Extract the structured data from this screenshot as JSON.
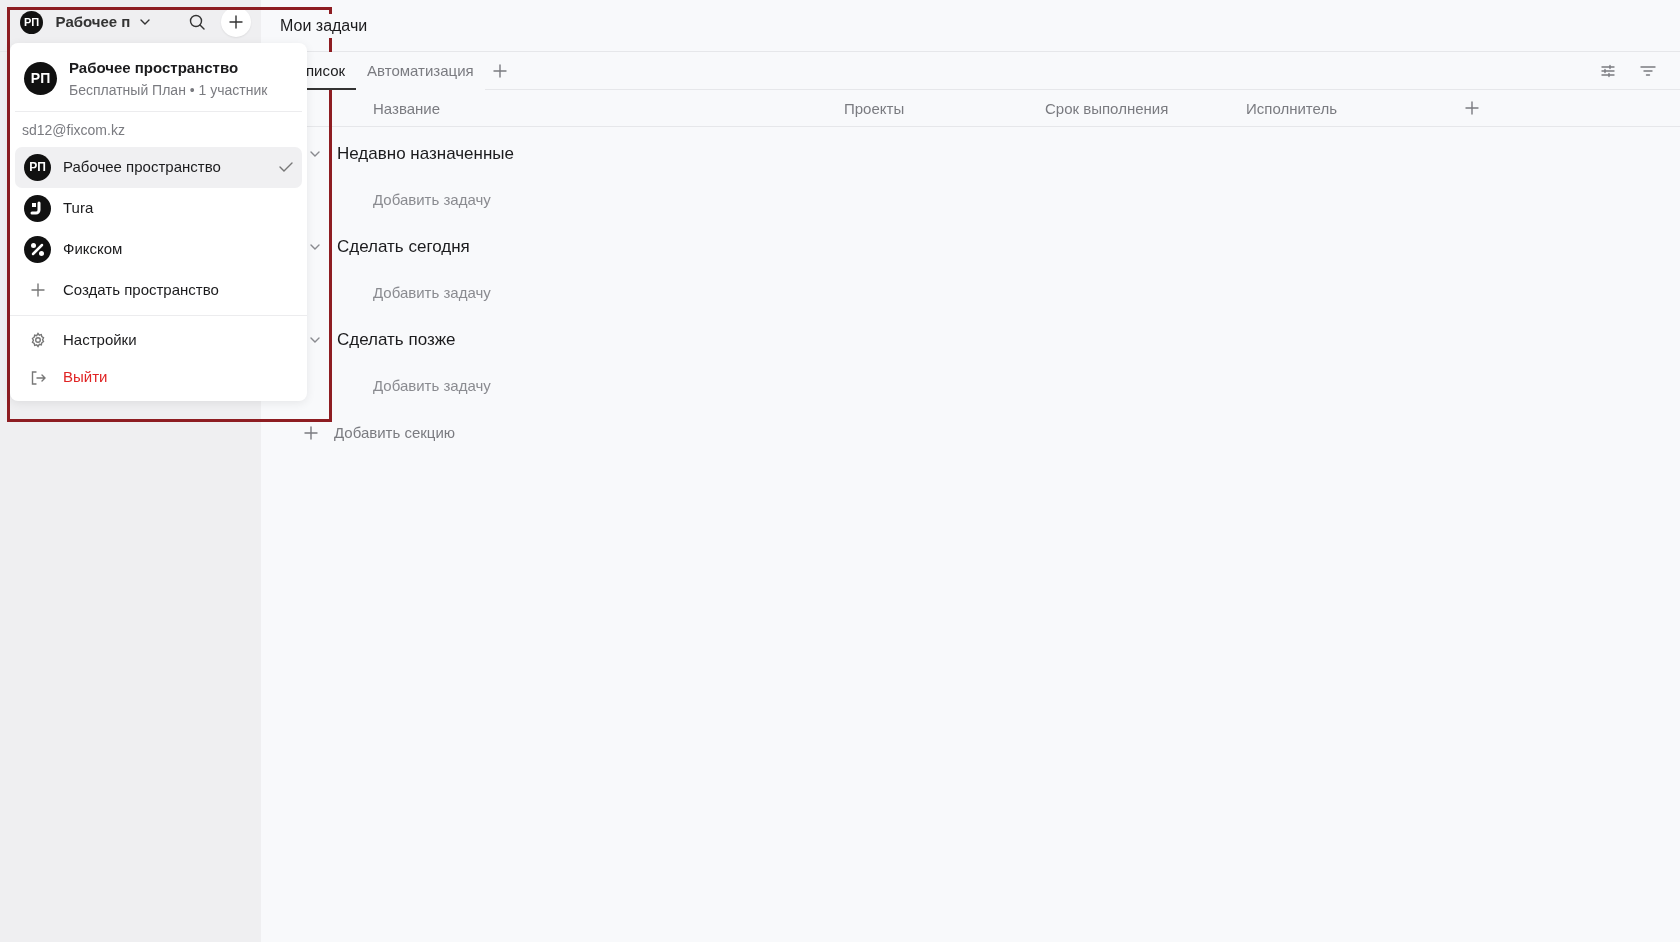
{
  "sidebar": {
    "workspace_avatar": "РП",
    "workspace_name": "Рабочее п"
  },
  "header": {
    "title": "Мои задачи"
  },
  "tabs": [
    {
      "label": "писок",
      "selected": true
    },
    {
      "label": "Автоматизация",
      "selected": false
    }
  ],
  "columns": [
    "Название",
    "Проекты",
    "Срок выполнения",
    "Исполнитель"
  ],
  "sections": [
    {
      "title": "Недавно назначенные",
      "expanded": true,
      "add_task": "Добавить задачу"
    },
    {
      "title": "Сделать сегодня",
      "expanded": true,
      "add_task": "Добавить задачу"
    },
    {
      "title": "Сделать позже",
      "expanded": true,
      "add_task": "Добавить задачу"
    }
  ],
  "add_section": "Добавить секцию",
  "workspace_menu": {
    "current": {
      "avatar": "РП",
      "name": "Рабочее пространство",
      "plan": "Бесплатный План • 1 участник"
    },
    "email": "sd12@fixcom.kz",
    "workspaces": [
      {
        "kind": "initials",
        "avatar": "РП",
        "name": "Рабочее пространство",
        "selected": true
      },
      {
        "kind": "bracket",
        "name": "Tura",
        "selected": false
      },
      {
        "kind": "percent",
        "name": "Фикском",
        "selected": false
      }
    ],
    "actions": [
      {
        "kind": "create",
        "label": "Создать пространство"
      },
      {
        "kind": "settings",
        "label": "Настройки"
      },
      {
        "kind": "logout",
        "label": "Выйти"
      }
    ]
  }
}
